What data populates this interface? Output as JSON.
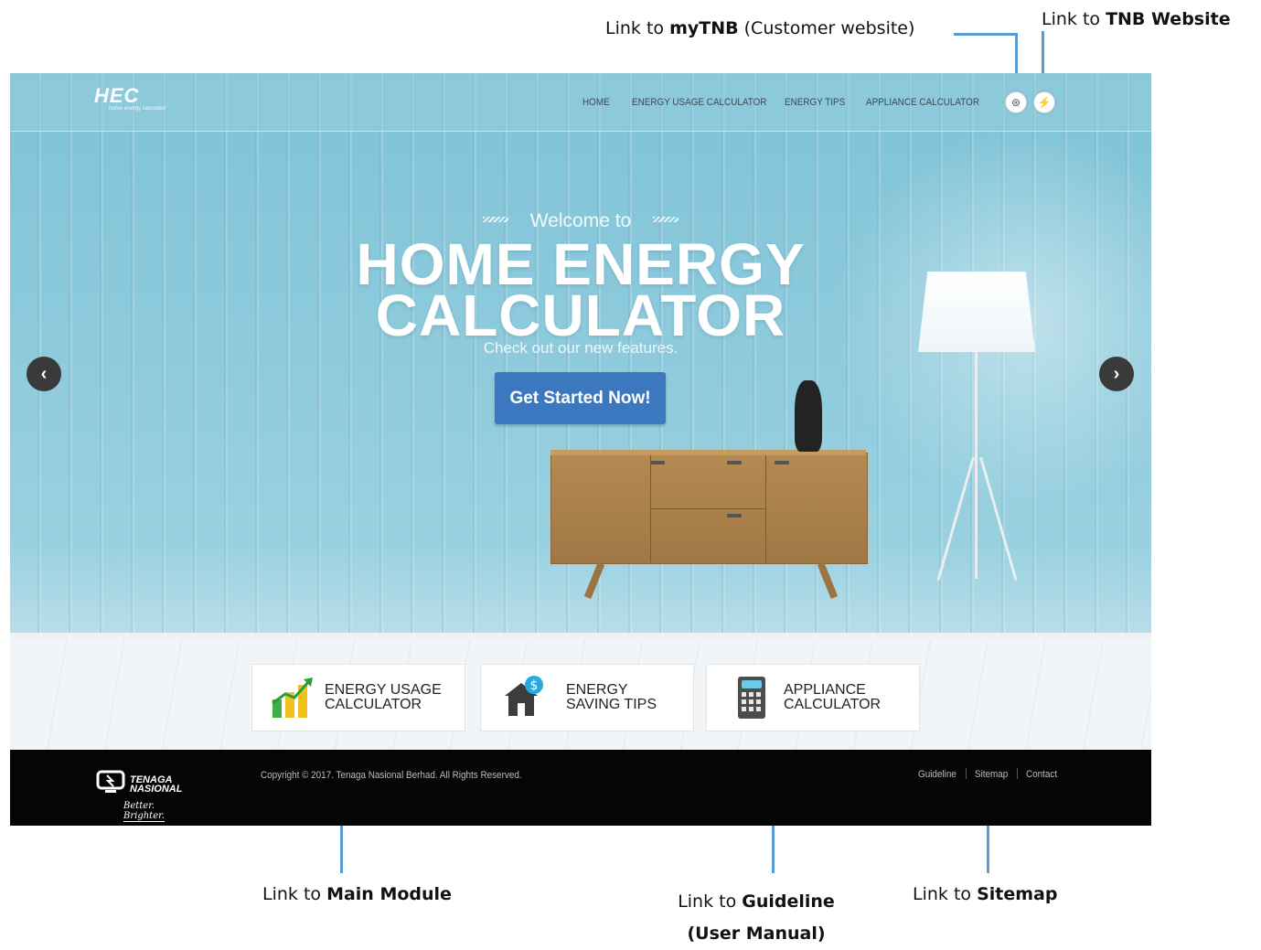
{
  "annotations": {
    "mytnb": {
      "prefix": "Link to ",
      "bold": "myTNB",
      "suffix": " (Customer website)"
    },
    "tnb": {
      "prefix": "Link to ",
      "bold": "TNB Website"
    },
    "main_module": {
      "prefix": "Link to ",
      "bold": "Main Module"
    },
    "guideline": {
      "prefix": "Link to ",
      "bold": "Guideline",
      "bold2": "(User Manual)"
    },
    "sitemap": {
      "prefix": "Link to ",
      "bold": "Sitemap"
    },
    "line_color": "#5b9bd5"
  },
  "header": {
    "logo": {
      "mark": "HEC",
      "tagline": "home energy calculator"
    },
    "nav": [
      "HOME",
      "ENERGY USAGE CALCULATOR",
      "ENERGY TIPS",
      "APPLIANCE CALCULATOR"
    ],
    "icons": [
      {
        "icon": "mytnb-icon",
        "glyph": "⊛"
      },
      {
        "icon": "tnb-icon",
        "glyph": "⚡"
      }
    ]
  },
  "hero": {
    "welcome": "Welcome to",
    "title_line1": "HOME ENERGY",
    "title_line2": "CALCULATOR",
    "subtitle": "Check out our new features.",
    "cta": "Get Started Now!",
    "cta_color": "#3b78bf",
    "prev": "‹",
    "next": "›"
  },
  "cards": [
    {
      "line1": "ENERGY USAGE",
      "line2": "CALCULATOR",
      "icon": "chart-growth-icon"
    },
    {
      "line1": "ENERGY",
      "line2": "SAVING TIPS",
      "icon": "house-dollar-icon"
    },
    {
      "line1": "APPLIANCE",
      "line2": "CALCULATOR",
      "icon": "calculator-icon"
    }
  ],
  "footer": {
    "brand_line1": "TENAGA",
    "brand_line2": "NASIONAL",
    "slogan": "Better. Brighter.",
    "copyright": "Copyright © 2017. Tenaga Nasional Berhad. All Rights Reserved.",
    "links": [
      "Guideline",
      "Sitemap",
      "Contact"
    ]
  }
}
